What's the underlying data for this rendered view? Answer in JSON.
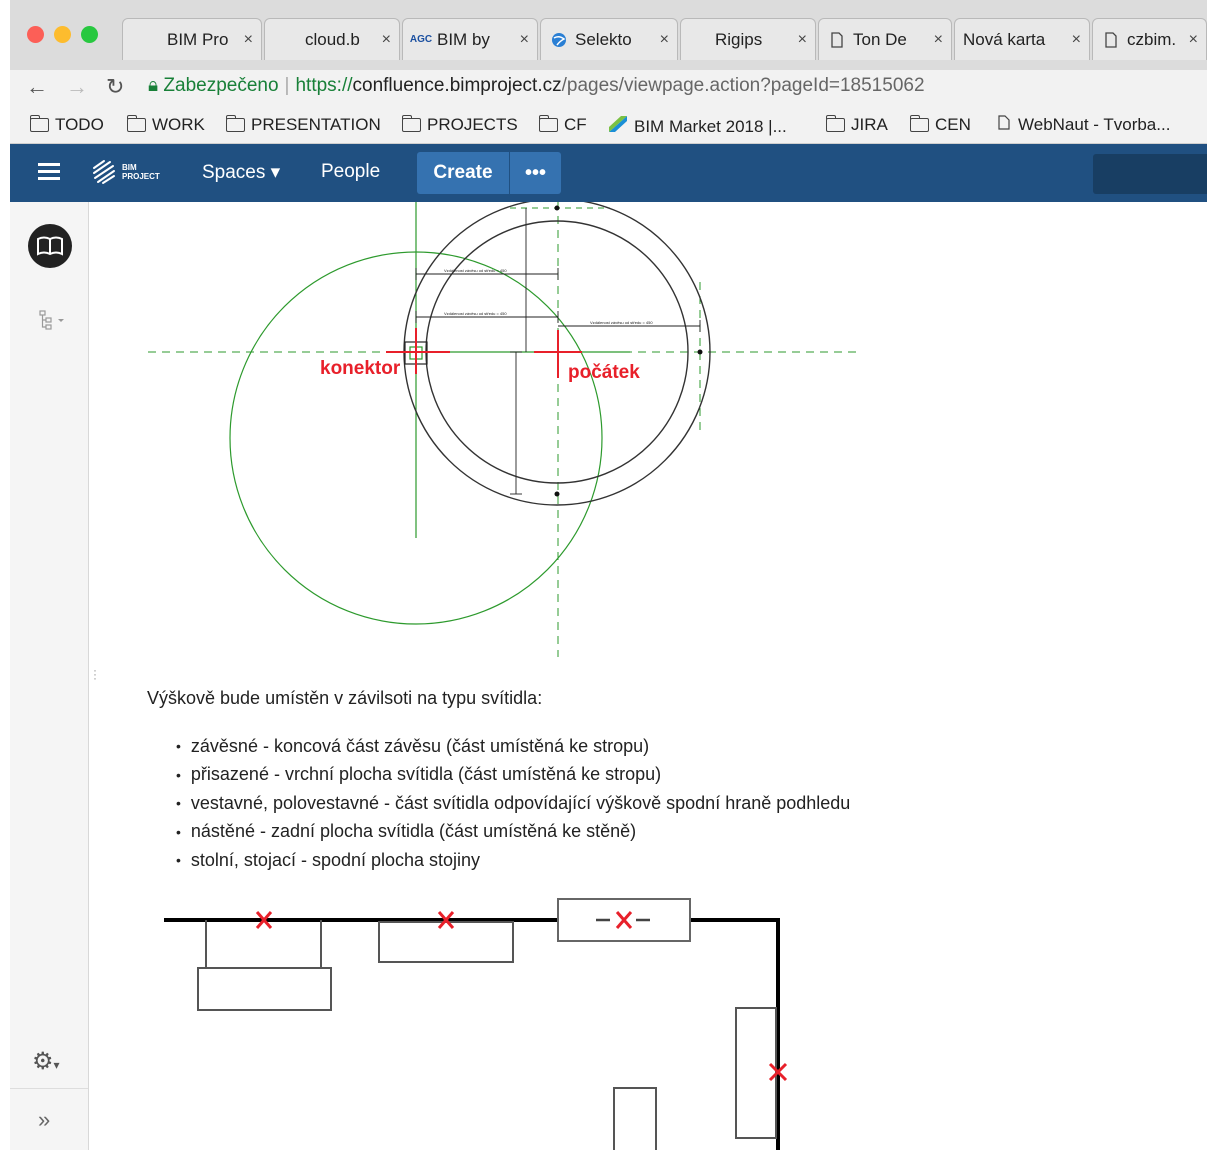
{
  "tabs": [
    {
      "label": "BIM Pro",
      "favicon": "none"
    },
    {
      "label": "cloud.b",
      "favicon": "none"
    },
    {
      "label": "BIM by",
      "favicon": "AGC"
    },
    {
      "label": "Selekto",
      "favicon": "globe-icon"
    },
    {
      "label": "Rigips",
      "favicon": "none"
    },
    {
      "label": "Ton De",
      "favicon": "document-icon"
    },
    {
      "label": "Nová karta",
      "favicon": "none"
    },
    {
      "label": "czbim.",
      "favicon": "document-icon"
    }
  ],
  "tab_close": "×",
  "address": {
    "secure_label": "Zabezpečeno",
    "scheme": "https://",
    "host": "confluence.bimproject.cz",
    "path": "/pages/viewpage.action?pageId=18515062"
  },
  "bookmarks": [
    {
      "label": "TODO",
      "icon": "folder-icon"
    },
    {
      "label": "WORK",
      "icon": "folder-icon"
    },
    {
      "label": "PRESENTATION",
      "icon": "folder-icon"
    },
    {
      "label": "PROJECTS",
      "icon": "folder-icon"
    },
    {
      "label": "CF",
      "icon": "folder-icon"
    },
    {
      "label": "BIM Market 2018 |...",
      "icon": "bim-market-logo-icon"
    },
    {
      "label": "JIRA",
      "icon": "folder-icon"
    },
    {
      "label": "CEN",
      "icon": "folder-icon"
    },
    {
      "label": "WebNaut - Tvorba...",
      "icon": "document-icon"
    }
  ],
  "header": {
    "logo_line1": "BIM",
    "logo_line2": "PROJECT",
    "spaces_label": "Spaces ▾",
    "people_label": "People",
    "create_label": "Create",
    "more_label": "•••"
  },
  "diagram1": {
    "label_connector": "konektor",
    "label_origin": "počátek",
    "dim_text": "Vzdálenost závěsu od středu = 450"
  },
  "content": {
    "intro": "Výškově bude umístěn v závilsoti na typu svítidla:",
    "items": [
      "závěsné - koncová část závěsu (část umístěná ke stropu)",
      "přisazené - vrchní plocha svítidla (část umístěná ke stropu)",
      "vestavné, polovestavné - část svítidla odpovídající výškově spodní hraně podhledu",
      "nástěné - zadní plocha svítidla (část umístěná ke stěně)",
      "stolní, stojací - spodní plocha stojiny"
    ]
  },
  "colors": {
    "header_bg": "#205081",
    "button_bg": "#3572b0",
    "accent_red": "#e8202a",
    "guide_green": "#1a9a1a"
  }
}
